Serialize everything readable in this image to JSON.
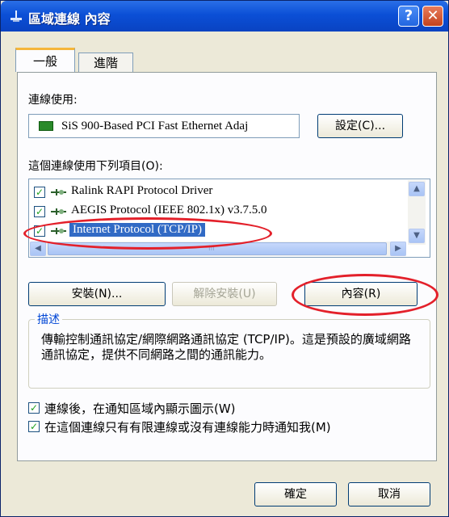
{
  "window": {
    "title": "區域連線 內容"
  },
  "titlebar": {
    "help_glyph": "?",
    "close_glyph": "✕"
  },
  "tabs": [
    {
      "label": "一般",
      "active": true
    },
    {
      "label": "進階",
      "active": false
    }
  ],
  "connect_using": {
    "label": "連線使用:",
    "adapter": "SiS 900-Based PCI Fast Ethernet Adaj",
    "configure_label": "設定(C)..."
  },
  "components": {
    "label": "這個連線使用下列項目(O):",
    "items": [
      {
        "label": "Ralink RAPI Protocol Driver",
        "checked": true
      },
      {
        "label": "AEGIS Protocol (IEEE 802.1x) v3.7.5.0",
        "checked": true
      },
      {
        "label": "Internet Protocol (TCP/IP)",
        "checked": true,
        "selected": true
      }
    ],
    "scroll_thumb_glyph": "III"
  },
  "buttons": {
    "install": "安裝(N)...",
    "uninstall": "解除安裝(U)",
    "properties": "內容(R)",
    "ok": "確定",
    "cancel": "取消"
  },
  "description": {
    "title": "描述",
    "text": "傳輸控制通訊協定/網際網路通訊協定 (TCP/IP)。這是預設的廣域網路通訊協定，提供不同網路之間的通訊能力。"
  },
  "options": {
    "show_icon": {
      "label": "連線後，在通知區域內顯示圖示(W)",
      "checked": true
    },
    "notify_limited": {
      "label": "在這個連線只有有限連線或沒有連線能力時通知我(M)",
      "checked": true
    }
  },
  "colors": {
    "title_bar": "#0b4fd6",
    "selection": "#316ac5",
    "highlight_annotation": "#e3202a"
  }
}
